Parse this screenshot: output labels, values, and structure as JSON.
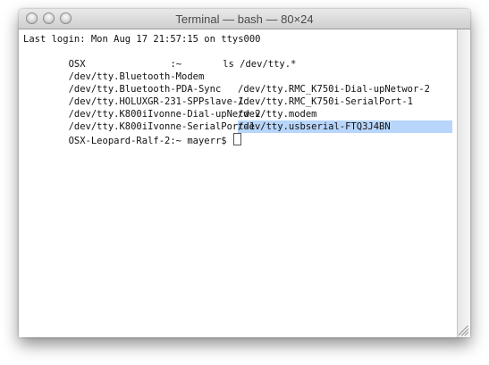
{
  "window": {
    "title": "Terminal — bash — 80×24"
  },
  "terminal": {
    "last_login": "Last login: Mon Aug 17 21:57:15 on ttys000",
    "prompt_line": {
      "host": "OSX",
      "path_part": ":~",
      "command": "ls /dev/tty.*"
    },
    "listing": {
      "col1": [
        "/dev/tty.Bluetooth-Modem",
        "/dev/tty.Bluetooth-PDA-Sync",
        "/dev/tty.HOLUXGR-231-SPPslave-1",
        "/dev/tty.K800iIvonne-Dial-upNetw-2",
        "/dev/tty.K800iIvonne-SerialPort-1"
      ],
      "col2": [
        "/dev/tty.RMC_K750i-Dial-upNetwor-2",
        "/dev/tty.RMC_K750i-SerialPort-1",
        "/dev/tty.modem",
        "/dev/tty.usbserial-FTQ3J4BN"
      ],
      "selected_item": "/dev/tty.usbserial-FTQ3J4BN"
    },
    "final_prompt": "OSX-Leopard-Ralf-2:~ mayerr$"
  },
  "colors": {
    "selection": "#b8d6fb",
    "text": "#111111"
  }
}
